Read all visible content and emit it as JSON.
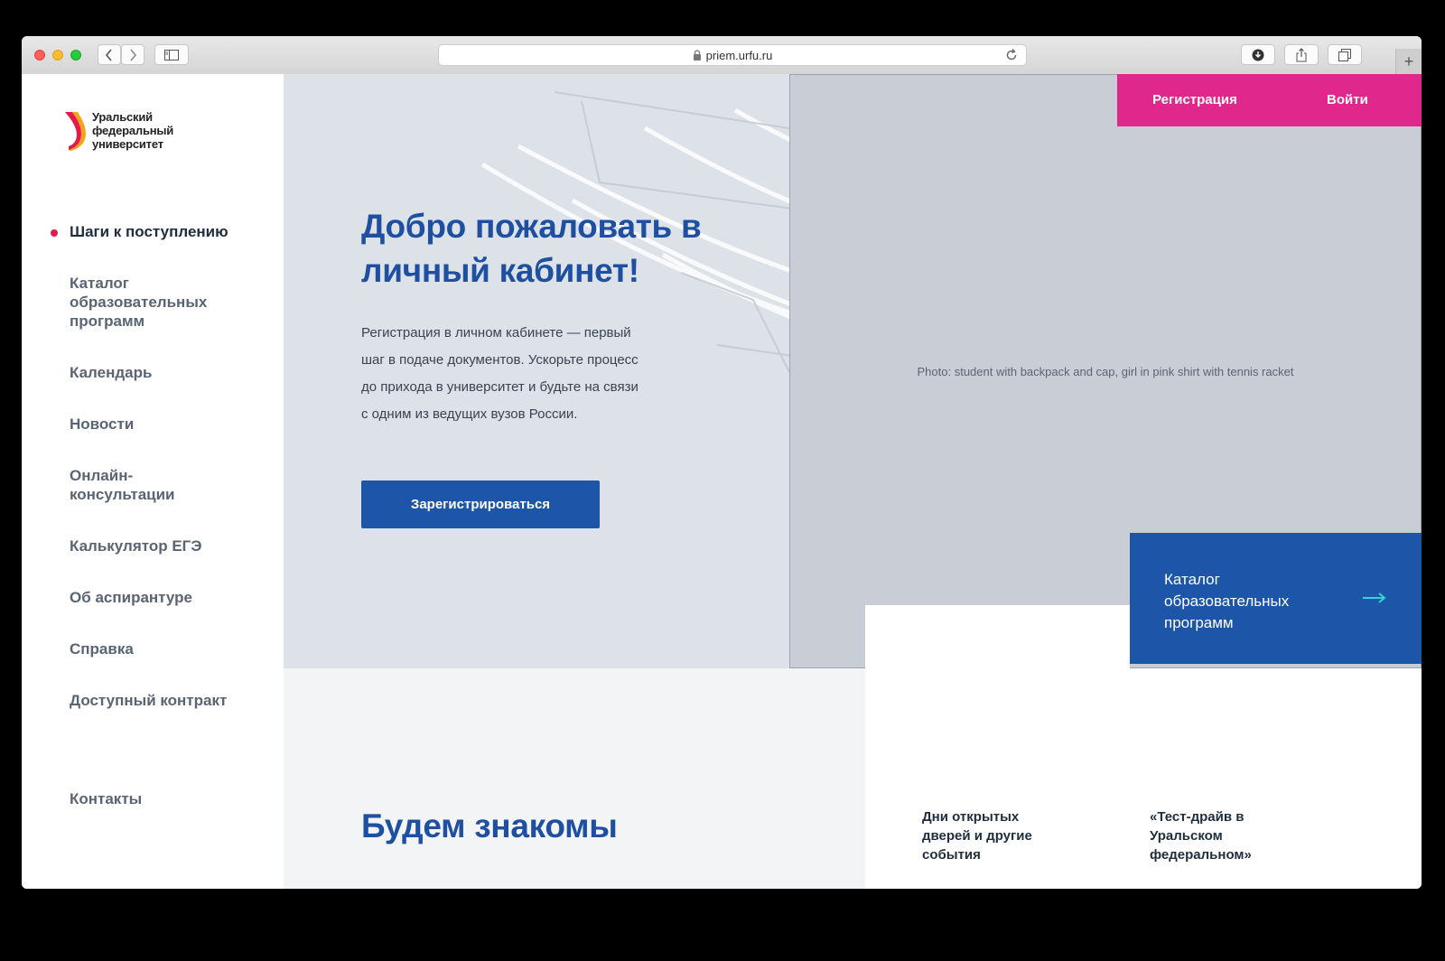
{
  "browser": {
    "url": "priem.urfu.ru",
    "new_tab_symbol": "+"
  },
  "logo": {
    "lines": [
      "Уральский",
      "федеральный",
      "университет"
    ]
  },
  "nav": {
    "items": [
      {
        "label": "Шаги к поступлению",
        "active": true
      },
      {
        "label": "Каталог образовательных программ"
      },
      {
        "label": "Календарь"
      },
      {
        "label": "Новости"
      },
      {
        "label": "Онлайн-консультации"
      },
      {
        "label": "Калькулятор ЕГЭ"
      },
      {
        "label": "Об аспирантуре"
      },
      {
        "label": "Справка"
      },
      {
        "label": "Доступный контракт"
      }
    ],
    "contacts": "Контакты"
  },
  "auth": {
    "register": "Регистрация",
    "login": "Войти"
  },
  "hero": {
    "title": "Добро пожаловать в личный кабинет!",
    "text": "Регистрация в личном кабинете — первый шаг в подаче документов. Ускорьте процесс до прихода в университет и будьте на связи с одним из ведущих вузов России.",
    "cta": "Зарегистрироваться",
    "photo_label": "Photo: student with backpack and cap, girl in pink shirt with tennis racket"
  },
  "catalog_card": {
    "label": "Каталог образовательных программ"
  },
  "lower": {
    "section_title": "Будем знакомы",
    "events": [
      "Дни открытых дверей и другие события",
      "«Тест-драйв в Уральском федеральном»"
    ]
  },
  "colors": {
    "brand_blue": "#1d56a8",
    "accent_pink": "#e0288c",
    "active_dot": "#e6194b",
    "hero_bg": "#dde1e8"
  }
}
